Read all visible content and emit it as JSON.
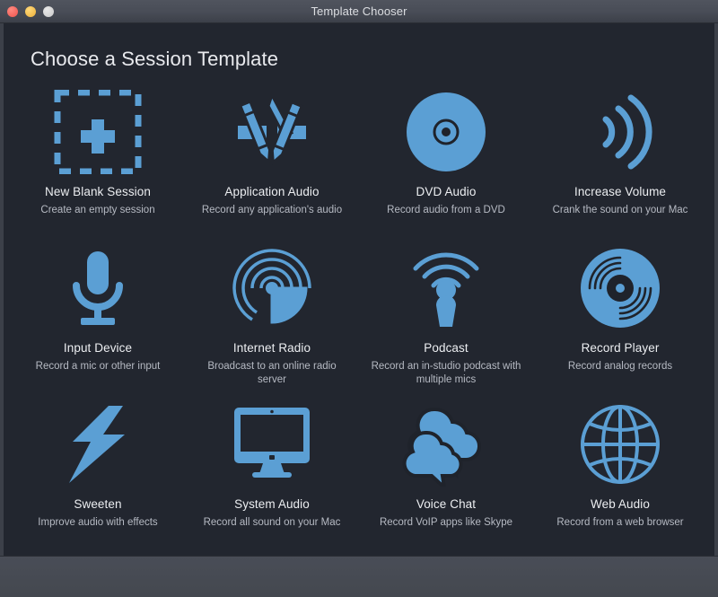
{
  "window": {
    "title": "Template Chooser",
    "traffic_lights": [
      {
        "name": "close",
        "color": "#f4645d"
      },
      {
        "name": "minimize",
        "color": "#f2bc4c"
      },
      {
        "name": "zoom",
        "color": "#d2d2d2"
      }
    ]
  },
  "colors": {
    "accent": "#5b9fd4",
    "background": "#22262f",
    "chrome": "#484c56",
    "title_text": "#eceef1",
    "desc_text": "#b6bac3"
  },
  "main": {
    "heading": "Choose a Session Template",
    "templates": [
      {
        "icon": "new-blank-session-icon",
        "title": "New Blank Session",
        "desc": "Create an empty session"
      },
      {
        "icon": "application-audio-icon",
        "title": "Application Audio",
        "desc": "Record any application's audio"
      },
      {
        "icon": "dvd-audio-icon",
        "title": "DVD Audio",
        "desc": "Record audio from a DVD"
      },
      {
        "icon": "increase-volume-icon",
        "title": "Increase Volume",
        "desc": "Crank the sound on your Mac"
      },
      {
        "icon": "input-device-icon",
        "title": "Input Device",
        "desc": "Record a mic or other input"
      },
      {
        "icon": "internet-radio-icon",
        "title": "Internet Radio",
        "desc": "Broadcast to an online radio server"
      },
      {
        "icon": "podcast-icon",
        "title": "Podcast",
        "desc": "Record an in-studio podcast with multiple mics"
      },
      {
        "icon": "record-player-icon",
        "title": "Record Player",
        "desc": "Record analog records"
      },
      {
        "icon": "sweeten-icon",
        "title": "Sweeten",
        "desc": "Improve audio with effects"
      },
      {
        "icon": "system-audio-icon",
        "title": "System Audio",
        "desc": "Record all sound on your Mac"
      },
      {
        "icon": "voice-chat-icon",
        "title": "Voice Chat",
        "desc": "Record VoIP apps like Skype"
      },
      {
        "icon": "web-audio-icon",
        "title": "Web Audio",
        "desc": "Record from a web browser"
      }
    ]
  }
}
